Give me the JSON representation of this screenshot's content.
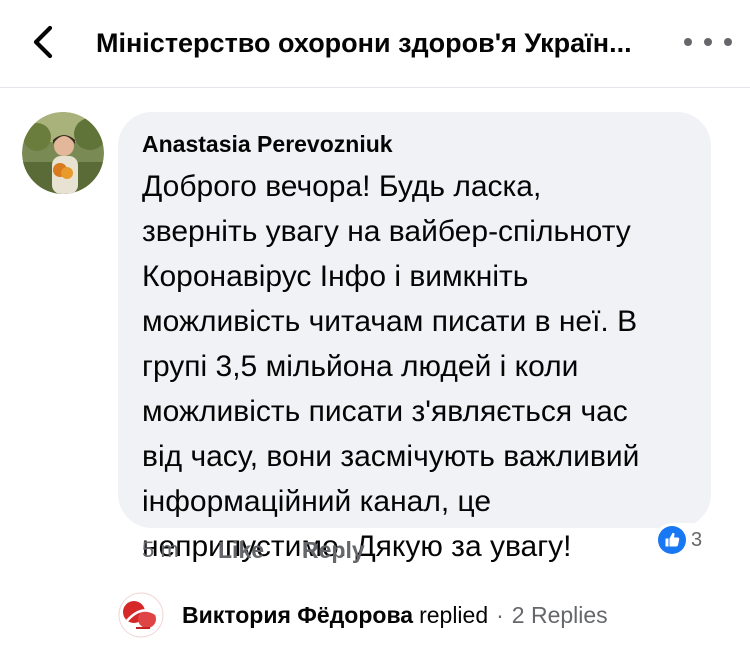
{
  "header": {
    "title": "Міністерство охорони здоров'я Україн...",
    "back_icon": "chevron-left-icon",
    "more_icon": "more-horizontal-icon"
  },
  "comment": {
    "author": "Anastasia Perevozniuk",
    "text_lines": [
      "Доброго вечора! Будь ласка,",
      "зверніть увагу на вайбер-спільноту",
      "Коронавірус Інфо і вимкніть",
      "можливість читачам писати в неї. В",
      "групі 3,5 мільйона людей і коли",
      "можливість писати з'являється час",
      "від часу, вони засмічують важливий",
      "інформаційний канал, це",
      "неприпустимо. Дякую за увагу!"
    ],
    "time": "5 m",
    "like_label": "Like",
    "reply_label": "Reply",
    "reactions": {
      "icon": "thumbs-up-icon",
      "count": "3",
      "color": "#1877f2"
    }
  },
  "reply_summary": {
    "name": "Виктория Фёдорова",
    "verb": "replied",
    "separator": "·",
    "count_label": "2 Replies"
  },
  "colors": {
    "bubble": "#f0f2f5",
    "secondary_text": "#65676b",
    "like_blue": "#1877f2"
  }
}
